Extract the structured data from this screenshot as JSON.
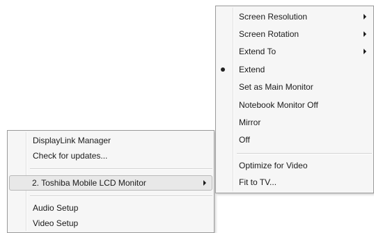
{
  "main_menu": {
    "items": [
      {
        "label": "DisplayLink Manager"
      },
      {
        "label": "Check for updates..."
      },
      {
        "label": "2. Toshiba Mobile LCD Monitor",
        "has_submenu": true,
        "highlighted": true
      },
      {
        "label": "Audio Setup"
      },
      {
        "label": "Video Setup"
      }
    ]
  },
  "submenu": {
    "items": [
      {
        "label": "Screen Resolution",
        "has_submenu": true
      },
      {
        "label": "Screen Rotation",
        "has_submenu": true
      },
      {
        "label": "Extend To",
        "has_submenu": true
      },
      {
        "label": "Extend",
        "selected": true
      },
      {
        "label": "Set as Main Monitor"
      },
      {
        "label": "Notebook Monitor Off"
      },
      {
        "label": "Mirror"
      },
      {
        "label": "Off"
      },
      {
        "label": "Optimize for Video"
      },
      {
        "label": "Fit to TV..."
      }
    ]
  },
  "icons": {
    "submenu_arrow": "chevron-right-icon",
    "selected_mark": "radio-bullet-icon"
  }
}
